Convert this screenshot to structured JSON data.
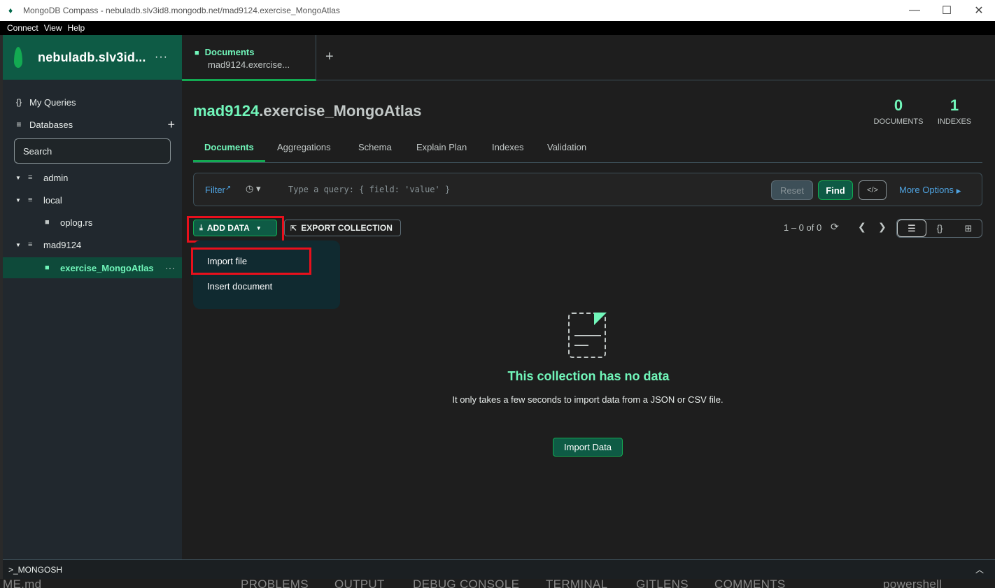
{
  "window": {
    "title": "MongoDB Compass - nebuladb.slv3id8.mongodb.net/mad9124.exercise_MongoAtlas",
    "controls": [
      "—",
      "☐",
      "✕"
    ]
  },
  "menu": [
    "Connect",
    "View",
    "Help"
  ],
  "sidebar": {
    "connection_name": "nebuladb.slv3id...",
    "connection_more": "···",
    "my_queries": "My Queries",
    "databases": "Databases",
    "search_placeholder": "Search",
    "tree": [
      {
        "label": "admin",
        "kind": "db"
      },
      {
        "label": "local",
        "kind": "db"
      },
      {
        "label": "oplog.rs",
        "kind": "collection"
      },
      {
        "label": "mad9124",
        "kind": "db"
      },
      {
        "label": "exercise_MongoAtlas",
        "kind": "collection",
        "active": true
      }
    ],
    "row_more": "···"
  },
  "tabs": {
    "active_title": "Documents",
    "active_subtitle": "mad9124.exercise...",
    "add": "+"
  },
  "collection": {
    "db": "mad9124",
    "name": ".exercise_MongoAtlas",
    "documents_count": "0",
    "documents_label": "DOCUMENTS",
    "indexes_count": "1",
    "indexes_label": "INDEXES"
  },
  "subtabs": [
    "Documents",
    "Aggregations",
    "Schema",
    "Explain Plan",
    "Indexes",
    "Validation"
  ],
  "filter": {
    "label": "Filter",
    "placeholder": "Type a query: { field: 'value' }",
    "reset": "Reset",
    "find": "Find",
    "code": "</>",
    "more_options": "More Options"
  },
  "toolbar": {
    "add_data": "ADD DATA",
    "export_collection": "EXPORT COLLECTION",
    "pagination": "1 – 0 of 0"
  },
  "add_data_menu": [
    "Import file",
    "Insert document"
  ],
  "empty_state": {
    "title": "This collection has no data",
    "description": "It only takes a few seconds to import data from a JSON or CSV file.",
    "button": "Import Data"
  },
  "mongosh": {
    "label": ">_MONGOSH"
  },
  "background_vscode": {
    "left_text": "ME.md",
    "panels": [
      "PROBLEMS",
      "OUTPUT",
      "DEBUG CONSOLE",
      "TERMINAL",
      "GITLENS",
      "COMMENTS"
    ],
    "terminal": "powershell"
  },
  "colors": {
    "accent": "#13aa52",
    "accent_text": "#71f6ba",
    "link": "#4fa3e0",
    "highlight_box": "#e8101c",
    "sidebar_header": "#0e5b45"
  }
}
